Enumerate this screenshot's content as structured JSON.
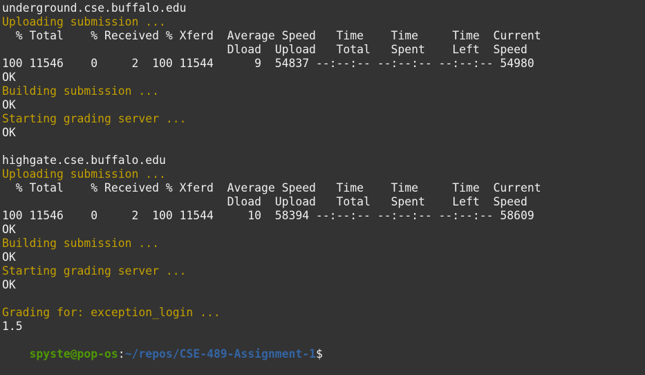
{
  "terminal": {
    "lines": [
      {
        "text": "underground.cse.buffalo.edu",
        "color": "white"
      },
      {
        "text": "Uploading submission ...",
        "color": "yellow"
      },
      {
        "text": "  % Total    % Received % Xferd  Average Speed   Time    Time     Time  Current",
        "color": "white"
      },
      {
        "text": "                                 Dload  Upload   Total   Spent    Left  Speed",
        "color": "white"
      },
      {
        "text": "100 11546    0     2  100 11544      9  54837 --:--:-- --:--:-- --:--:-- 54980",
        "color": "white"
      },
      {
        "text": "OK",
        "color": "white"
      },
      {
        "text": "Building submission ...",
        "color": "yellow"
      },
      {
        "text": "OK",
        "color": "white"
      },
      {
        "text": "Starting grading server ...",
        "color": "yellow"
      },
      {
        "text": "OK",
        "color": "white"
      },
      {
        "text": "",
        "color": "white"
      },
      {
        "text": "highgate.cse.buffalo.edu",
        "color": "white"
      },
      {
        "text": "Uploading submission ...",
        "color": "yellow"
      },
      {
        "text": "  % Total    % Received % Xferd  Average Speed   Time    Time     Time  Current",
        "color": "white"
      },
      {
        "text": "                                 Dload  Upload   Total   Spent    Left  Speed",
        "color": "white"
      },
      {
        "text": "100 11546    0     2  100 11544     10  58394 --:--:-- --:--:-- --:--:-- 58609",
        "color": "white"
      },
      {
        "text": "OK",
        "color": "white"
      },
      {
        "text": "Building submission ...",
        "color": "yellow"
      },
      {
        "text": "OK",
        "color": "white"
      },
      {
        "text": "Starting grading server ...",
        "color": "yellow"
      },
      {
        "text": "OK",
        "color": "white"
      },
      {
        "text": "",
        "color": "white"
      },
      {
        "text": "Grading for: exception_login ...",
        "color": "yellow"
      },
      {
        "text": "1.5",
        "color": "white"
      }
    ],
    "prompt": {
      "user_host": "spyste@pop-os",
      "separator": ":",
      "path": "~/repos/CSE-489-Assignment-1",
      "symbol": "$"
    }
  },
  "colors": {
    "background": "#333333",
    "foreground": "#f0f0f0",
    "yellow": "#c4a000",
    "green": "#4e9a06",
    "blue": "#3465a4"
  }
}
